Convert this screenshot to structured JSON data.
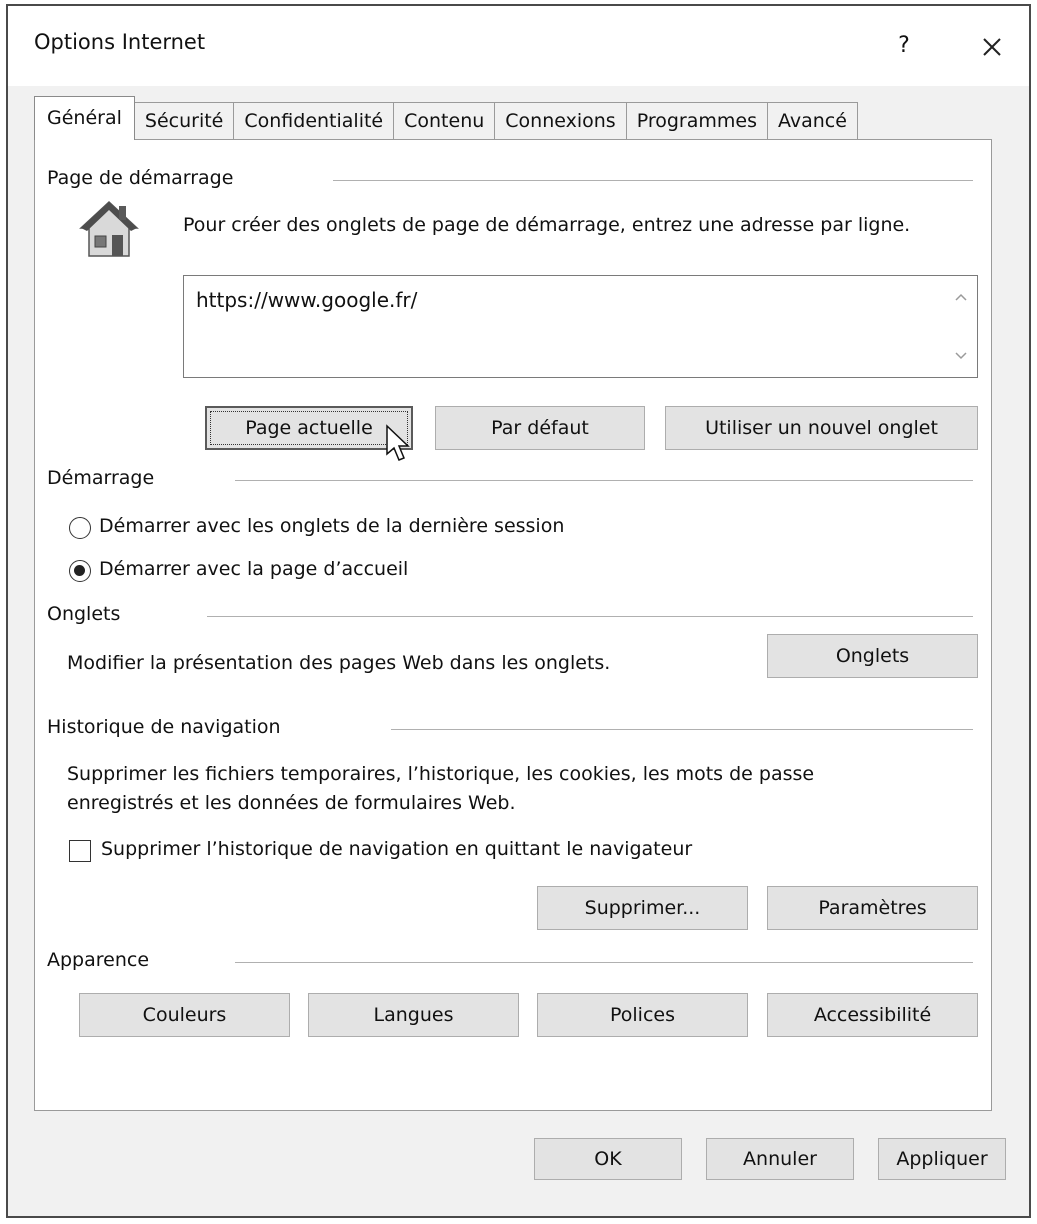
{
  "window": {
    "title": "Options Internet",
    "help_label": "?",
    "close_label": "×"
  },
  "tabs": [
    {
      "label": "Général"
    },
    {
      "label": "Sécurité"
    },
    {
      "label": "Confidentialité"
    },
    {
      "label": "Contenu"
    },
    {
      "label": "Connexions"
    },
    {
      "label": "Programmes"
    },
    {
      "label": "Avancé"
    }
  ],
  "homepage": {
    "section_title": "Page de démarrage",
    "instruction": "Pour créer des onglets de page de démarrage, entrez une adresse par ligne.",
    "url_value": "https://www.google.fr/",
    "buttons": {
      "current": "Page actuelle",
      "default": "Par défaut",
      "new_tab": "Utiliser un nouvel onglet"
    }
  },
  "startup": {
    "section_title": "Démarrage",
    "option_last_session": "Démarrer avec les onglets de la dernière session",
    "option_home_page": "Démarrer avec la page d’accueil",
    "selected": "home_page"
  },
  "tabs_section": {
    "section_title": "Onglets",
    "description": "Modifier la présentation des pages Web dans les onglets.",
    "button": "Onglets"
  },
  "history": {
    "section_title": "Historique de navigation",
    "description_line1": "Supprimer les fichiers temporaires, l’historique, les cookies, les mots de passe",
    "description_line2": "enregistrés et les données de formulaires Web.",
    "checkbox_label": "Supprimer l’historique de navigation en quittant le navigateur",
    "checkbox_checked": false,
    "delete_button": "Supprimer...",
    "settings_button": "Paramètres"
  },
  "appearance": {
    "section_title": "Apparence",
    "colors_button": "Couleurs",
    "languages_button": "Langues",
    "fonts_button": "Polices",
    "accessibility_button": "Accessibilité"
  },
  "footer": {
    "ok": "OK",
    "cancel": "Annuler",
    "apply": "Appliquer"
  },
  "icons": {
    "home": "house-icon",
    "cursor": "mouse-pointer-icon"
  }
}
